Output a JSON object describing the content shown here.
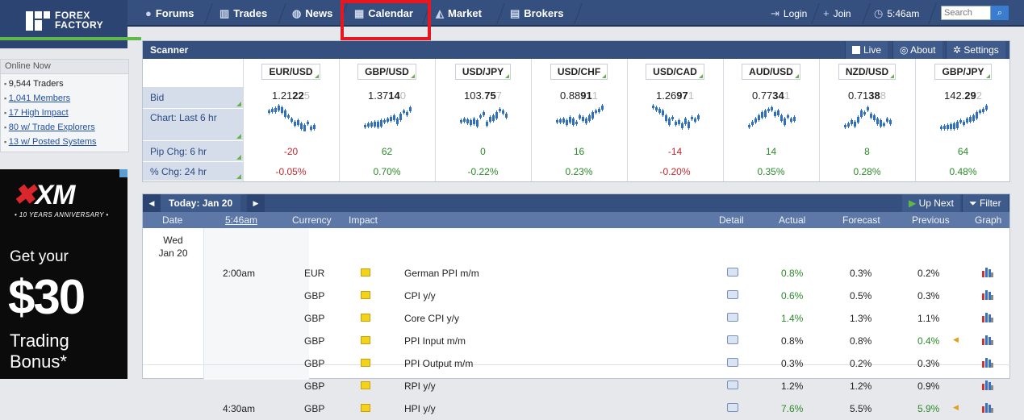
{
  "logo": {
    "line1": "FOREX",
    "line2": "FACTORY"
  },
  "nav": [
    {
      "label": "Forums",
      "icon": "forums-icon"
    },
    {
      "label": "Trades",
      "icon": "trades-icon"
    },
    {
      "label": "News",
      "icon": "news-icon"
    },
    {
      "label": "Calendar",
      "icon": "calendar-icon"
    },
    {
      "label": "Market",
      "icon": "market-icon"
    },
    {
      "label": "Brokers",
      "icon": "brokers-icon"
    }
  ],
  "account": {
    "login": "Login",
    "join": "Join",
    "time": "5:46am"
  },
  "search": {
    "placeholder": "Search"
  },
  "online": {
    "title": "Online Now",
    "items": [
      "9,544 Traders",
      "1,041 Members",
      "17 High Impact",
      "80 w/ Trade Explorers",
      "13 w/ Posted Systems"
    ]
  },
  "ad": {
    "brand": "XM",
    "anniversary": "• 10 YEARS ANNIVERSARY •",
    "get": "Get your",
    "amount": "$30",
    "line1": "Trading",
    "line2": "Bonus*"
  },
  "scanner": {
    "title": "Scanner",
    "live": "Live",
    "about": "About",
    "settings": "Settings",
    "labels": {
      "bid": "Bid",
      "chart": "Chart: Last 6 hr",
      "pip": "Pip Chg: 6 hr",
      "pct": "% Chg: 24 hr"
    },
    "pairs": [
      {
        "name": "EUR/USD",
        "bid_a": "1.21",
        "bid_b": "22",
        "bid_c": "5",
        "pip": "-20",
        "pct": "-0.05%",
        "dir": "dn"
      },
      {
        "name": "GBP/USD",
        "bid_a": "1.37",
        "bid_b": "14",
        "bid_c": "0",
        "pip": "62",
        "pct": "0.70%",
        "dir": "up"
      },
      {
        "name": "USD/JPY",
        "bid_a": "103.",
        "bid_b": "75",
        "bid_c": "7",
        "pip": "0",
        "pct": "-0.22%",
        "dir": "zero"
      },
      {
        "name": "USD/CHF",
        "bid_a": "0.88",
        "bid_b": "91",
        "bid_c": "1",
        "pip": "16",
        "pct": "0.23%",
        "dir": "up"
      },
      {
        "name": "USD/CAD",
        "bid_a": "1.26",
        "bid_b": "97",
        "bid_c": "1",
        "pip": "-14",
        "pct": "-0.20%",
        "dir": "dn"
      },
      {
        "name": "AUD/USD",
        "bid_a": "0.77",
        "bid_b": "34",
        "bid_c": "1",
        "pip": "14",
        "pct": "0.35%",
        "dir": "up"
      },
      {
        "name": "NZD/USD",
        "bid_a": "0.71",
        "bid_b": "38",
        "bid_c": "8",
        "pip": "8",
        "pct": "0.28%",
        "dir": "up"
      },
      {
        "name": "GBP/JPY",
        "bid_a": "142.",
        "bid_b": "29",
        "bid_c": "2",
        "pip": "64",
        "pct": "0.48%",
        "dir": "up"
      }
    ]
  },
  "calendar": {
    "today": "Today: Jan 20",
    "up_next": "Up Next",
    "filter": "Filter",
    "headers": {
      "date": "Date",
      "time": "5:46am",
      "currency": "Currency",
      "impact": "Impact",
      "detail": "Detail",
      "actual": "Actual",
      "forecast": "Forecast",
      "previous": "Previous",
      "graph": "Graph"
    },
    "day": "Wed",
    "date": "Jan 20",
    "events": [
      {
        "time": "2:00am",
        "currency": "EUR",
        "event": "German PPI m/m",
        "actual": "0.8%",
        "actual_color": "green",
        "forecast": "0.3%",
        "previous": "0.2%",
        "previous_color": "black"
      },
      {
        "time": "",
        "currency": "GBP",
        "event": "CPI y/y",
        "actual": "0.6%",
        "actual_color": "green",
        "forecast": "0.5%",
        "previous": "0.3%",
        "previous_color": "black"
      },
      {
        "time": "",
        "currency": "GBP",
        "event": "Core CPI y/y",
        "actual": "1.4%",
        "actual_color": "green",
        "forecast": "1.3%",
        "previous": "1.1%",
        "previous_color": "black"
      },
      {
        "time": "",
        "currency": "GBP",
        "event": "PPI Input m/m",
        "actual": "0.8%",
        "actual_color": "black",
        "forecast": "0.8%",
        "previous": "0.4%",
        "previous_color": "green"
      },
      {
        "time": "",
        "currency": "GBP",
        "event": "PPI Output m/m",
        "actual": "0.3%",
        "actual_color": "black",
        "forecast": "0.2%",
        "previous": "0.3%",
        "previous_color": "black"
      },
      {
        "time": "",
        "currency": "GBP",
        "event": "RPI y/y",
        "actual": "1.2%",
        "actual_color": "black",
        "forecast": "1.2%",
        "previous": "0.9%",
        "previous_color": "black"
      },
      {
        "time": "4:30am",
        "currency": "GBP",
        "event": "HPI y/y",
        "actual": "7.6%",
        "actual_color": "green",
        "forecast": "5.5%",
        "previous": "5.9%",
        "previous_color": "green"
      }
    ]
  },
  "colors": {
    "nav": "#35507e",
    "accent_green": "#5fb848",
    "highlight_red": "#e8171f"
  }
}
